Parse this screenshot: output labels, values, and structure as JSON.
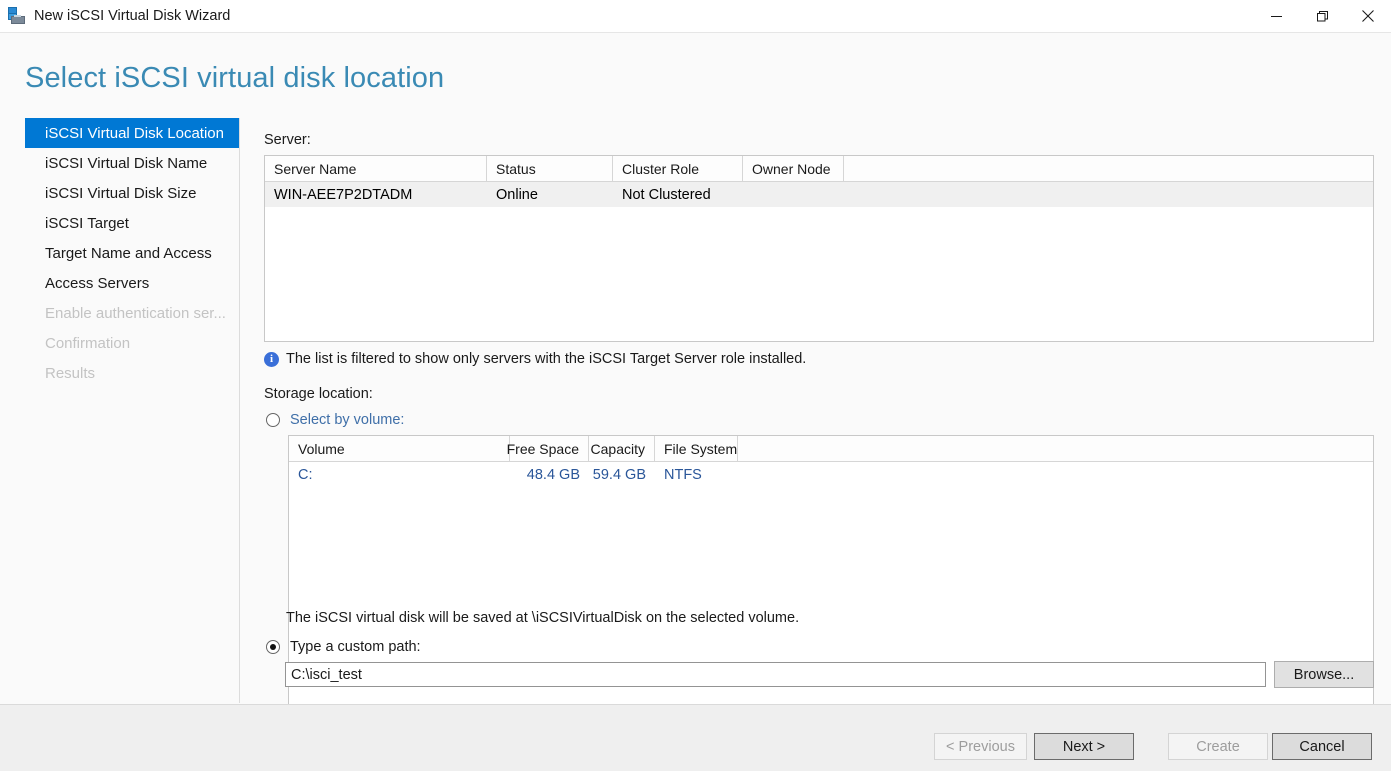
{
  "window": {
    "title": "New iSCSI Virtual Disk Wizard",
    "icon": "iscsi-virtual-disk-icon",
    "controls": {
      "minimize": "minimize-icon",
      "restore": "restore-icon",
      "close": "close-icon"
    }
  },
  "page": {
    "heading": "Select iSCSI virtual disk location",
    "heading_color": "#3a8ab4"
  },
  "sidebar": {
    "active_index": 0,
    "items": [
      {
        "label": "iSCSI Virtual Disk Location",
        "state": "active"
      },
      {
        "label": "iSCSI Virtual Disk Name",
        "state": "enabled"
      },
      {
        "label": "iSCSI Virtual Disk Size",
        "state": "enabled"
      },
      {
        "label": "iSCSI Target",
        "state": "enabled"
      },
      {
        "label": "Target Name and Access",
        "state": "enabled"
      },
      {
        "label": "Access Servers",
        "state": "enabled"
      },
      {
        "label": "Enable authentication ser...",
        "state": "disabled"
      },
      {
        "label": "Confirmation",
        "state": "disabled"
      },
      {
        "label": "Results",
        "state": "disabled"
      }
    ]
  },
  "server_section": {
    "label": "Server:",
    "columns": [
      "Server Name",
      "Status",
      "Cluster Role",
      "Owner Node"
    ],
    "rows": [
      {
        "server_name": "WIN-AEE7P2DTADM",
        "status": "Online",
        "cluster_role": "Not Clustered",
        "owner_node": ""
      }
    ],
    "info": {
      "icon": "info-icon",
      "text": "The list is filtered to show only servers with the iSCSI Target Server role installed."
    }
  },
  "storage_section": {
    "label": "Storage location:",
    "select_by_volume": {
      "label": "Select by volume:",
      "selected": false
    },
    "volume_table": {
      "columns": [
        "Volume",
        "Free Space",
        "Capacity",
        "File System"
      ],
      "rows": [
        {
          "volume": "C:",
          "free_space": "48.4 GB",
          "capacity": "59.4 GB",
          "file_system": "NTFS"
        }
      ]
    },
    "save_hint": "The iSCSI virtual disk will be saved at \\iSCSIVirtualDisk on the selected volume.",
    "custom_path": {
      "label": "Type a custom path:",
      "selected": true,
      "value": "C:\\isci_test",
      "placeholder": "",
      "browse_label": "Browse..."
    }
  },
  "footer": {
    "previous_label": "< Previous",
    "next_label": "Next >",
    "create_label": "Create",
    "cancel_label": "Cancel"
  }
}
